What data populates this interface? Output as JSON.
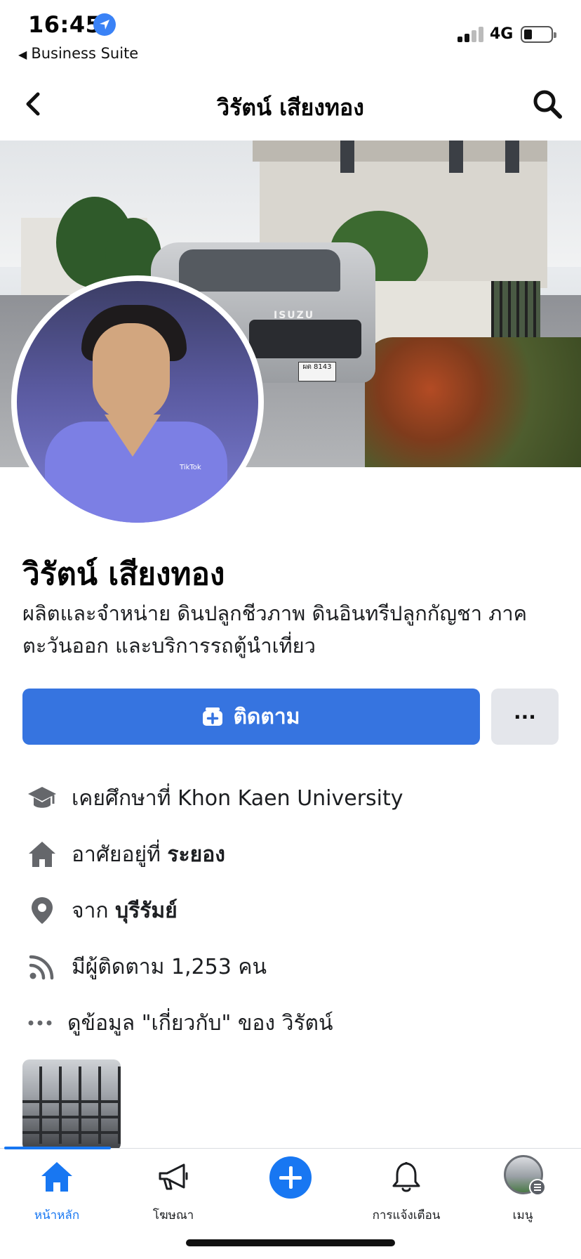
{
  "status_bar": {
    "time": "16:45",
    "back_app": "Business Suite",
    "network": "4G",
    "icons": [
      "location-arrow-icon",
      "signal-icon",
      "battery-icon"
    ]
  },
  "header": {
    "title": "วิรัตน์ เสียงทอง",
    "icons": [
      "back-chevron-icon",
      "search-icon"
    ]
  },
  "profile": {
    "name": "วิรัตน์ เสียงทอง",
    "bio": "ผลิตและจำหน่าย ดินปลูกชีวภาพ ดินอินทรีปลูกกัญชา ภาคตะวันออก และบริการรถตู้นำเที่ยว",
    "cover": {
      "truck_brand": "ISUZU",
      "plate": "ผต 8143"
    },
    "avatar_watermark": "TikTok"
  },
  "actions": {
    "follow_label": "ติดตาม",
    "more_label": "···"
  },
  "info": {
    "education_prefix": "เคยศึกษาที่",
    "education_value": "Khon Kaen University",
    "lives_prefix": "อาศัยอยู่ที่",
    "lives_value": "ระยอง",
    "from_prefix": "จาก",
    "from_value": "บุรีรัมย์",
    "followers_text": "มีผู้ติดตาม 1,253 คน",
    "about_text": "ดูข้อมูล \"เกี่ยวกับ\" ของ วิรัตน์"
  },
  "tabs": [
    {
      "label": "หน้าหลัก",
      "icon": "home-icon",
      "active": true
    },
    {
      "label": "โฆษณา",
      "icon": "megaphone-icon",
      "active": false
    },
    {
      "label": "",
      "icon": "create-plus-icon",
      "active": false
    },
    {
      "label": "การแจ้งเตือน",
      "icon": "bell-icon",
      "active": false
    },
    {
      "label": "เมนู",
      "icon": "menu-avatar-icon",
      "active": false
    }
  ],
  "colors": {
    "accent": "#1877f2",
    "follow_button": "#3674e0",
    "secondary_button": "#e4e6eb",
    "icon_gray": "#65676b"
  }
}
